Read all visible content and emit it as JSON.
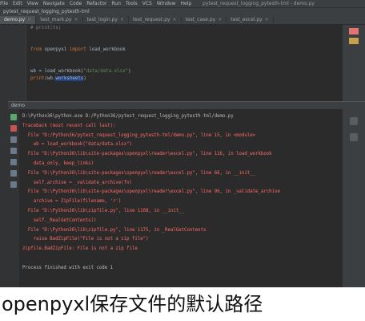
{
  "menubar": {
    "items": [
      "File",
      "Edit",
      "View",
      "Navigate",
      "Code",
      "Refactor",
      "Run",
      "Tools",
      "VCS",
      "Window",
      "Help"
    ],
    "window_title": "pytest_request_logging_pytesth-tml - demo.py"
  },
  "path": "pytest_request_logging_pytesth-tml",
  "tabs": [
    {
      "label": "demo.py",
      "active": true
    },
    {
      "label": "test_mark.py",
      "active": false
    },
    {
      "label": "test_login.py",
      "active": false
    },
    {
      "label": "test_request.py",
      "active": false
    },
    {
      "label": "test_case.py",
      "active": false
    },
    {
      "label": "test_excel.py",
      "active": false
    }
  ],
  "editor": {
    "lines": [
      {
        "parts": [
          {
            "t": "# print(ts)",
            "c": "cmt"
          }
        ]
      },
      {
        "parts": []
      },
      {
        "parts": []
      },
      {
        "parts": [
          {
            "t": "from",
            "c": "kw"
          },
          {
            "t": " openpyxl ",
            "c": ""
          },
          {
            "t": "import",
            "c": "kw"
          },
          {
            "t": " load_workbook",
            "c": ""
          }
        ]
      },
      {
        "parts": []
      },
      {
        "parts": []
      },
      {
        "parts": [
          {
            "t": "wb = load_workbook(",
            "c": ""
          },
          {
            "t": "\"data/data.xlsx\"",
            "c": "str"
          },
          {
            "t": ")",
            "c": ""
          }
        ]
      },
      {
        "parts": [
          {
            "t": "print",
            "c": "kw"
          },
          {
            "t": "(wb.",
            "c": ""
          },
          {
            "t": "worksheets",
            "c": "hl"
          },
          {
            "t": ")",
            "c": ""
          }
        ]
      }
    ]
  },
  "run": {
    "tab_label": "demo"
  },
  "console": {
    "lines": [
      {
        "t": "D:\\Python36\\python.exe D:/Python36/pytest_request_logging_pytesth-tml/demo.py",
        "c": "plain"
      },
      {
        "t": "Traceback (most recent call last):",
        "c": ""
      },
      {
        "t": "  File \"D:/Python36/pytest_request_logging_pytesth-tml/demo.py\", line 15, in <module>",
        "c": ""
      },
      {
        "t": "    wb = load_workbook(\"data/data.xlsx\")",
        "c": ""
      },
      {
        "t": "  File \"D:\\Python36\\lib\\site-packages\\openpyxl\\reader\\excel.py\", line 116, in load_workbook",
        "c": ""
      },
      {
        "t": "    data_only, keep_links)",
        "c": ""
      },
      {
        "t": "  File \"D:\\Python36\\lib\\site-packages\\openpyxl\\reader\\excel.py\", line 66, in __init__",
        "c": ""
      },
      {
        "t": "    self.archive = _validate_archive(fn)",
        "c": ""
      },
      {
        "t": "  File \"D:\\Python36\\lib\\site-packages\\openpyxl\\reader\\excel.py\", line 96, in _validate_archive",
        "c": ""
      },
      {
        "t": "    archive = ZipFile(filename, 'r')",
        "c": ""
      },
      {
        "t": "  File \"D:\\Python36\\lib\\zipfile.py\", line 1108, in __init__",
        "c": ""
      },
      {
        "t": "    self._RealGetContents()",
        "c": ""
      },
      {
        "t": "  File \"D:\\Python36\\lib\\zipfile.py\", line 1175, in _RealGetContents",
        "c": ""
      },
      {
        "t": "    raise BadZipFile(\"File is not a zip file\")",
        "c": ""
      },
      {
        "t": "zipfile.BadZipFile: File is not a zip file",
        "c": ""
      },
      {
        "t": "",
        "c": ""
      },
      {
        "t": "Process finished with exit code 1",
        "c": "plain"
      }
    ]
  },
  "caption": "openpyxl保存文件的默认路径",
  "colors": {
    "bg": "#2b2b2b",
    "panel": "#3c3f41",
    "error": "#ff6b68",
    "link": "#5394ec",
    "keyword": "#cc7832",
    "string": "#6a8759"
  }
}
